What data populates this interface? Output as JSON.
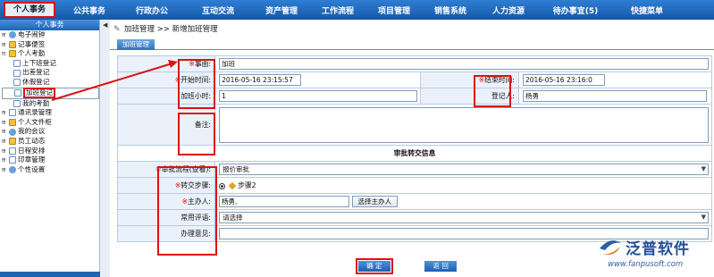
{
  "topnav": {
    "items": [
      "个人事务",
      "公共事务",
      "行政办公",
      "互动交流",
      "资产管理",
      "工作流程",
      "项目管理",
      "销售系统",
      "人力资源",
      "待办事宜(5)",
      "快捷菜单"
    ]
  },
  "sidebar": {
    "title": "个人事务",
    "items": [
      {
        "label": "电子闹钟",
        "toggle": "⊞"
      },
      {
        "label": "记事便签",
        "toggle": "⊞"
      },
      {
        "label": "个人考勤",
        "toggle": "⊟"
      },
      {
        "label": "上下班登记"
      },
      {
        "label": "出差登记"
      },
      {
        "label": "休假登记"
      },
      {
        "label": "加班登记"
      },
      {
        "label": "我的考勤"
      },
      {
        "label": "通讯录管理",
        "toggle": "⊞"
      },
      {
        "label": "个人文件柜",
        "toggle": "⊞"
      },
      {
        "label": "我的会议",
        "toggle": "⊞"
      },
      {
        "label": "员工动态",
        "toggle": "⊞"
      },
      {
        "label": "日程安排",
        "toggle": "⊞"
      },
      {
        "label": "印章管理",
        "toggle": "⊞"
      },
      {
        "label": "个性设置",
        "toggle": "⊞"
      }
    ]
  },
  "breadcrumb": {
    "parent": "加班管理",
    "sep": ">>",
    "current": "新增加班管理"
  },
  "tab": "加班管理",
  "form": {
    "subject_label": "事由:",
    "subject_value": "加班",
    "start_label": "开始时间:",
    "start_value": "2016-05-16 23:15:57",
    "end_label": "结束时间:",
    "end_value": "2016-05-16 23:16:0",
    "hours_label": "加班小时:",
    "hours_value": "1",
    "registrant_label": "登记人:",
    "registrant_value": "杨勇",
    "remark_label": "备注:",
    "section_title": "审批转交信息",
    "flow_label": "审批流程(查看):",
    "flow_value": "报价审批",
    "step_label": "转交步骤:",
    "step_value": "步骤2",
    "handler_label": "主办人:",
    "handler_value": "杨勇,",
    "handler_button": "选择主办人",
    "phrase_label": "常用评语:",
    "phrase_value": "请选择",
    "opinion_label": "办理意见:",
    "opinion_value": ""
  },
  "actions": {
    "ok": "确 定",
    "back": "返 回"
  },
  "watermark": {
    "brand": "泛普软件",
    "url": "www.fanpusoft.com"
  },
  "colors": {
    "nav": "#1458a8",
    "highlight": "#d11",
    "label_bg": "#eaf1fa"
  }
}
